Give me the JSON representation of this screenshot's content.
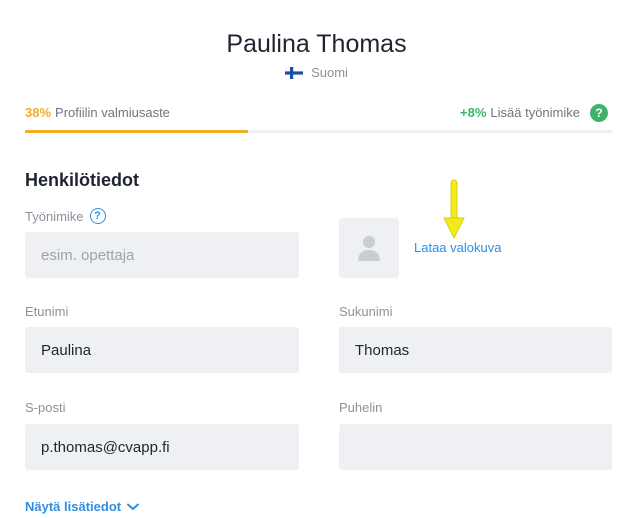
{
  "header": {
    "name": "Paulina Thomas",
    "country": "Suomi",
    "flag_icon": "finland-flag-icon"
  },
  "progress": {
    "percent_label": "38%",
    "percent_value": 0.38,
    "label": "Profiilin valmiusaste",
    "boost_label": "+8%",
    "boost_text": "Lisää työnimike",
    "help_symbol": "?",
    "accent_color": "#f0ad26",
    "boost_color": "#3fb36b"
  },
  "section": {
    "title": "Henkilötiedot"
  },
  "form": {
    "job_title": {
      "label": "Työnimike",
      "placeholder": "esim. opettaja",
      "value": ""
    },
    "photo": {
      "upload_label": "Lataa valokuva"
    },
    "first_name": {
      "label": "Etunimi",
      "value": "Paulina"
    },
    "last_name": {
      "label": "Sukunimi",
      "value": "Thomas"
    },
    "email": {
      "label": "S-posti",
      "value": "p.thomas@cvapp.fi"
    },
    "phone": {
      "label": "Puhelin",
      "value": ""
    }
  },
  "more": {
    "label": "Näytä lisätiedot"
  },
  "colors": {
    "link": "#2f8fe0",
    "field_bg": "#eef0f4",
    "annotation_arrow": "#f2ea1a"
  }
}
